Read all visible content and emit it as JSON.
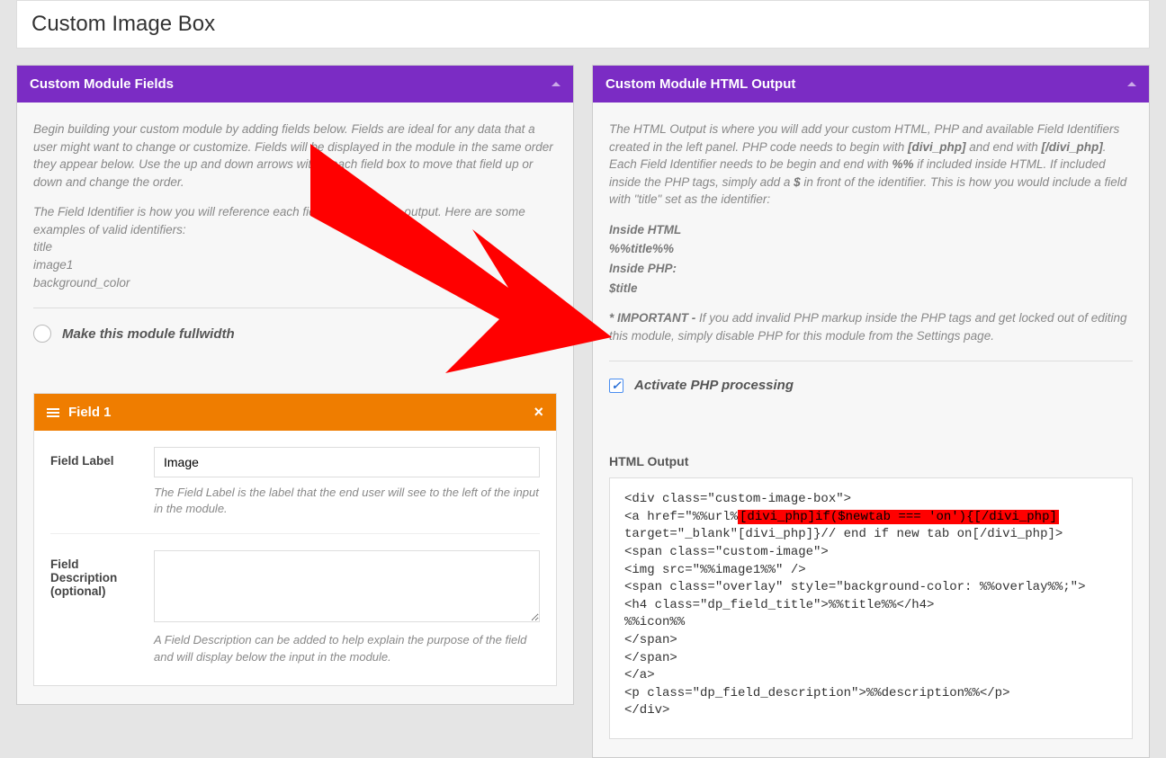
{
  "page_title": "Custom Image Box",
  "left": {
    "panel_title": "Custom Module Fields",
    "intro_p1": "Begin building your custom module by adding fields below. Fields are ideal for any data that a user might want to change or customize. Fields will be displayed in the module in the same order they appear below. Use the up and down arrows within each field box to move that field up or down and change the order.",
    "intro_p2": "The Field Identifier is how you will reference each field in your HTML output. Here are some examples of valid identifiers:",
    "ident1": "title",
    "ident2": "image1",
    "ident3": "background_color",
    "fullwidth_label": "Make this module fullwidth",
    "field1": {
      "header": "Field 1",
      "label_label": "Field Label",
      "label_value": "Image",
      "label_help": "The Field Label is the label that the end user will see to the left of the input in the module.",
      "desc_label": "Field Description (optional)",
      "desc_value": "",
      "desc_help": "A Field Description can be added to help explain the purpose of the field and will display below the input in the module."
    }
  },
  "right": {
    "panel_title": "Custom Module HTML Output",
    "intro_p1_a": "The HTML Output is where you will add your custom HTML, PHP and available Field Identifiers created in the left panel. PHP code needs to begin with ",
    "divi_php": "[divi_php]",
    "intro_p1_b": " and end with ",
    "divi_php_close": "[/divi_php]",
    "intro_p1_c": ". Each Field Identifier needs to be begin and end with ",
    "percent": "%%",
    "intro_p1_d": " if included inside HTML. If included inside the PHP tags, simply add a ",
    "dollar": "$",
    "intro_p1_e": " in front of the identifier. This is how you would include a field with \"title\" set as the identifier:",
    "inside_html_label": "Inside HTML",
    "inside_html_ex": "%%title%%",
    "inside_php_label": "Inside PHP:",
    "inside_php_ex": "$title",
    "important_label": "* IMPORTANT - ",
    "important_text": "If you add invalid PHP markup inside the PHP tags and get locked out of editing this module, simply disable PHP for this module from the Settings page.",
    "activate_php_label": "Activate PHP processing",
    "html_output_label": "HTML Output",
    "code": {
      "l1": "<div class=\"custom-image-box\">",
      "l2a": "<a href=\"%%url%",
      "l2b": "[divi_php]if($newtab === 'on'){[/divi_php]",
      "l3": "target=\"_blank\"[divi_php]}// end if new tab on[/divi_php]>",
      "l4": "<span class=\"custom-image\">",
      "l5": "<img src=\"%%image1%%\" />",
      "l6": "<span class=\"overlay\" style=\"background-color: %%overlay%%;\">",
      "l7": "<h4 class=\"dp_field_title\">%%title%%</h4>",
      "l8": "%%icon%%",
      "l9": "</span>",
      "l10": "</span>",
      "l11": "</a>",
      "l12": "<p class=\"dp_field_description\">%%description%%</p>",
      "l13": "</div>"
    }
  }
}
